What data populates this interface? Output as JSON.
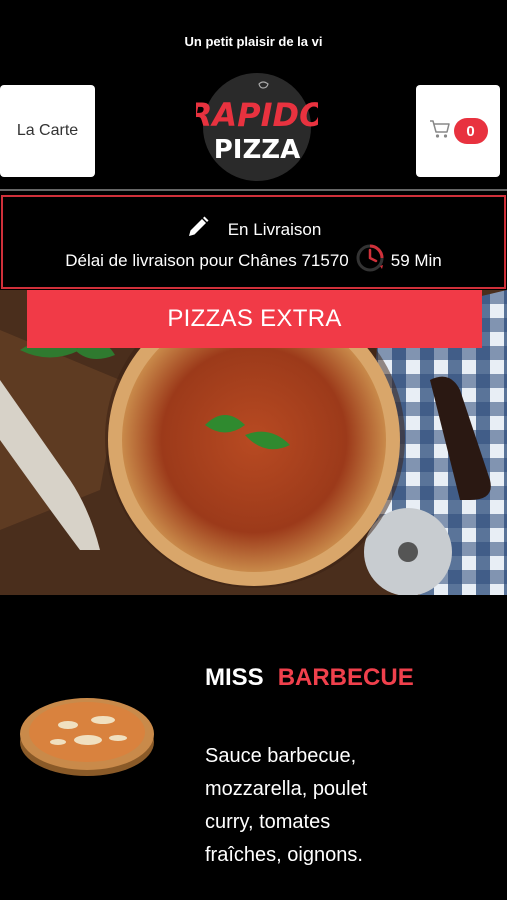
{
  "header": {
    "tagline": "Un petit plaisir de la vi",
    "menu_label": "La Carte",
    "cart_count": "0",
    "logo": {
      "line1": "RAPIDO",
      "line2": "PIZZA"
    }
  },
  "delivery": {
    "mode": "En Livraison",
    "delay_text": "Délai de livraison pour Chânes 71570",
    "delay_time": "59 Min"
  },
  "category": {
    "title": "PIZZAS EXTRA"
  },
  "product": {
    "name_part1": "MISS",
    "name_part2": "BARBECUE",
    "description": "Sauce barbecue, mozzarella, poulet curry, tomates fraîches, oignons."
  },
  "colors": {
    "accent": "#f13a47",
    "background": "#000000"
  },
  "icons": [
    "pencil-icon",
    "clock-icon",
    "cart-icon"
  ]
}
